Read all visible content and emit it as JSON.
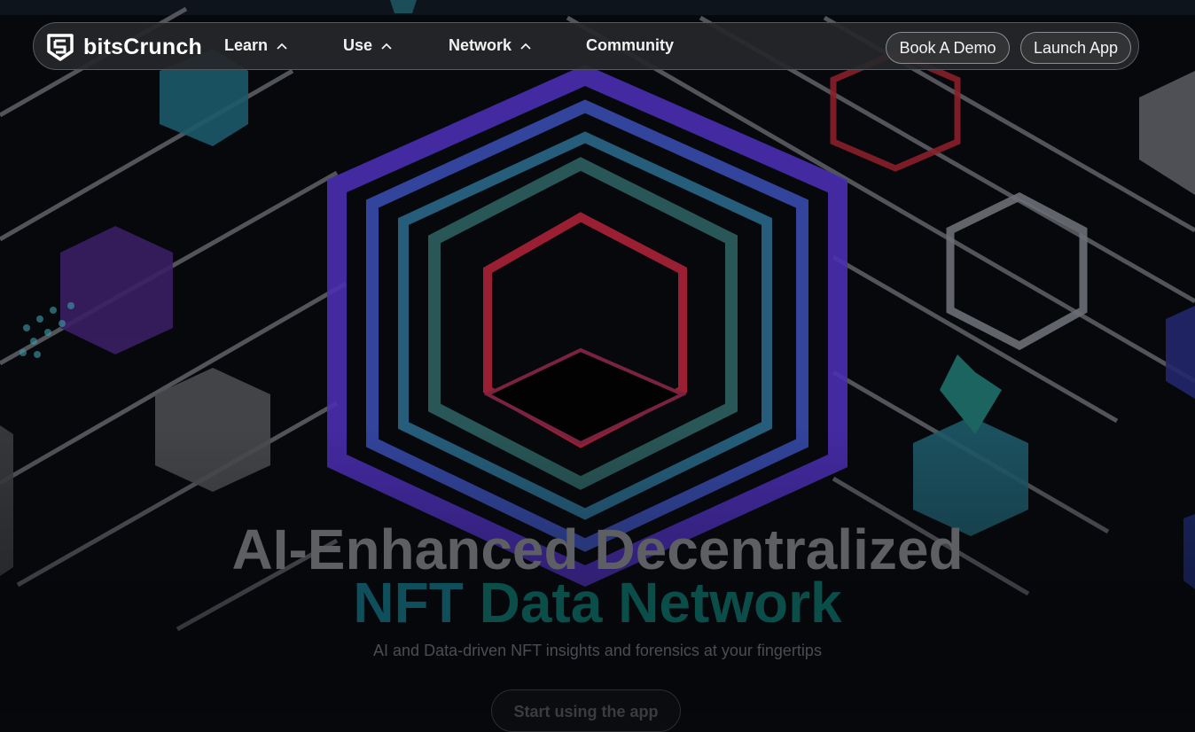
{
  "brand": {
    "name": "bitsCrunch"
  },
  "nav": {
    "items": [
      {
        "label": "Learn",
        "icon": "chevron-up-icon"
      },
      {
        "label": "Use",
        "icon": "chevron-up-icon"
      },
      {
        "label": "Network",
        "icon": "chevron-up-icon"
      },
      {
        "label": "Community"
      }
    ],
    "book_demo_label": "Book A Demo",
    "launch_app_label": "Launch App"
  },
  "hero": {
    "headline_line1": "AI-Enhanced Decentralized",
    "headline_line2_part1": "NFT",
    "headline_line2_part2": "Data Network",
    "subheadline": "AI and Data-driven NFT insights and forensics at your fingertips",
    "cta_label": "Start using the app"
  },
  "colors": {
    "background": "#07080c",
    "navbar_bg": "#26272a",
    "headline_gray": "#5d5f63",
    "headline_teal": "#0b4d49"
  }
}
